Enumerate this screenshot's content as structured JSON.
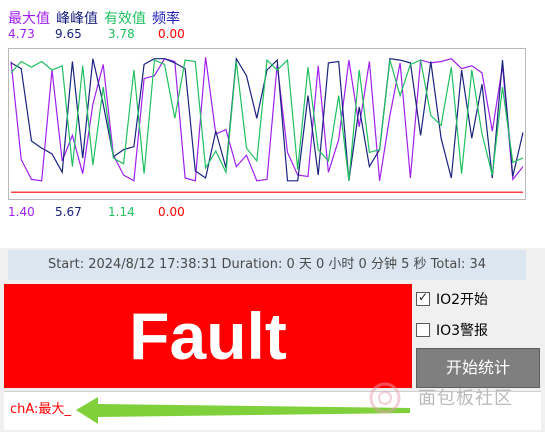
{
  "legend": [
    {
      "label": "最大值",
      "color": "#a020f0"
    },
    {
      "label": "峰峰值",
      "color": "#1a237e"
    },
    {
      "label": "有效值",
      "color": "#20c060"
    },
    {
      "label": "频率",
      "color": "#2020c0"
    }
  ],
  "top_values": [
    {
      "value": "4.73",
      "color": "#a020f0"
    },
    {
      "value": "9.65",
      "color": "#1a237e"
    },
    {
      "value": "3.78",
      "color": "#20c060"
    },
    {
      "value": "0.00",
      "color": "#ff0000"
    }
  ],
  "bottom_values": [
    {
      "value": "1.40",
      "color": "#a020f0"
    },
    {
      "value": "5.67",
      "color": "#1a237e"
    },
    {
      "value": "1.14",
      "color": "#20c060"
    },
    {
      "value": "0.00",
      "color": "#ff0000"
    }
  ],
  "status": {
    "text": "Start: 2024/8/12 17:38:31  Duration: 0 天 0 小时 0 分钟 5 秒  Total: 34"
  },
  "fault": {
    "label": "Fault",
    "color": "#ff0000"
  },
  "controls": {
    "io2_label": "IO2开始",
    "io2_checked": true,
    "io3_label": "IO3警报",
    "io3_checked": false,
    "start_button": "开始统计"
  },
  "channel_label": "chA:最大_",
  "watermark_text": "面包板社区",
  "chart_data": {
    "type": "line",
    "ylim": [
      0,
      10
    ],
    "x": [
      0,
      1,
      2,
      3,
      4,
      5,
      6,
      7,
      8,
      9,
      10,
      11,
      12,
      13,
      14,
      15,
      16,
      17,
      18,
      19,
      20,
      21,
      22,
      23,
      24,
      25,
      26,
      27,
      28,
      29,
      30,
      31,
      32,
      33,
      34,
      35,
      36,
      37,
      38,
      39,
      40,
      41,
      42,
      43,
      44,
      45,
      46,
      47,
      48,
      49,
      50
    ],
    "series": [
      {
        "color": "#a020f0",
        "values": [
          9.4,
          2.5,
          1.1,
          1.0,
          8.8,
          2.4,
          4.2,
          1.5,
          6.4,
          9.2,
          2.8,
          1.4,
          1.0,
          8.2,
          8.4,
          9.6,
          9.4,
          1.2,
          1.0,
          9.7,
          4.3,
          4.6,
          2.0,
          2.8,
          1.0,
          1.1,
          9.2,
          3.0,
          1.4,
          1.3,
          9.1,
          1.6,
          3.9,
          9.5,
          4.8,
          9.4,
          1.0,
          5.6,
          9.3,
          1.2,
          9.5,
          9.3,
          9.4,
          9.6,
          8.9,
          9.1,
          8.6,
          4.5,
          9.1,
          1.1,
          2.0
        ]
      },
      {
        "color": "#1a237e",
        "values": [
          9.3,
          8.9,
          3.8,
          3.3,
          2.9,
          1.6,
          9.4,
          2.6,
          9.6,
          6.4,
          2.7,
          3.2,
          3.4,
          9.2,
          9.6,
          9.6,
          9.3,
          8.9,
          1.7,
          1.2,
          4.5,
          1.9,
          9.6,
          8.4,
          5.4,
          8.8,
          9.5,
          1.0,
          1.0,
          7.0,
          1.4,
          9.3,
          9.4,
          1.0,
          6.2,
          2.0,
          3.2,
          9.6,
          9.5,
          9.3,
          4.2,
          9.4,
          4.0,
          1.2,
          8.8,
          4.0,
          7.8,
          1.2,
          9.5,
          1.3,
          4.4
        ]
      },
      {
        "color": "#20c060",
        "values": [
          8.6,
          9.4,
          9.0,
          9.4,
          8.8,
          9.1,
          2.0,
          9.1,
          2.1,
          7.6,
          2.6,
          2.2,
          8.8,
          1.5,
          9.5,
          9.2,
          5.4,
          9.5,
          9.4,
          1.9,
          3.1,
          1.6,
          9.4,
          3.3,
          2.4,
          9.5,
          8.8,
          9.5,
          1.8,
          9.0,
          3.2,
          2.4,
          7.0,
          1.0,
          8.8,
          3.0,
          3.2,
          9.5,
          7.0,
          9.2,
          9.5,
          5.6,
          4.9,
          9.0,
          1.5,
          8.8,
          4.3,
          1.4,
          7.6,
          2.3,
          2.6
        ]
      },
      {
        "color": "#ff0000",
        "values": [
          0.2,
          0.2,
          0.2,
          0.2,
          0.2,
          0.2,
          0.2,
          0.2,
          0.2,
          0.2,
          0.2,
          0.2,
          0.2,
          0.2,
          0.2,
          0.2,
          0.2,
          0.2,
          0.2,
          0.2,
          0.2,
          0.2,
          0.2,
          0.2,
          0.2,
          0.2,
          0.2,
          0.2,
          0.2,
          0.2,
          0.2,
          0.2,
          0.2,
          0.2,
          0.2,
          0.2,
          0.2,
          0.2,
          0.2,
          0.2,
          0.2,
          0.2,
          0.2,
          0.2,
          0.2,
          0.2,
          0.2,
          0.2,
          0.2,
          0.2,
          0.2
        ]
      }
    ],
    "grid": false
  }
}
